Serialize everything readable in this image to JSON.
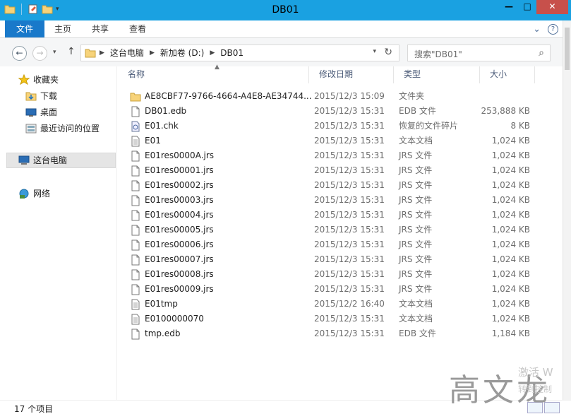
{
  "window": {
    "title": "DB01",
    "minimize": "—",
    "maximize": "□",
    "close": "✕"
  },
  "ribbon": {
    "tabs": [
      "文件",
      "主页",
      "共享",
      "查看"
    ],
    "collapse": "⌄",
    "help": "?"
  },
  "address": {
    "crumbs": [
      "这台电脑",
      "新加卷 (D:)",
      "DB01"
    ],
    "search_placeholder": "搜索\"DB01\""
  },
  "nav": {
    "items": [
      {
        "label": "收藏夹",
        "icon": "star-icon"
      },
      {
        "label": "下载",
        "icon": "download-folder-icon"
      },
      {
        "label": "桌面",
        "icon": "desktop-icon"
      },
      {
        "label": "最近访问的位置",
        "icon": "recent-places-icon"
      },
      {
        "label": "这台电脑",
        "icon": "computer-icon"
      },
      {
        "label": "网络",
        "icon": "network-icon"
      }
    ]
  },
  "columns": [
    "名称",
    "修改日期",
    "类型",
    "大小"
  ],
  "files": [
    {
      "name": "AE8CBF77-9766-4664-A4E8-AE34744...",
      "date": "2015/12/3 15:09",
      "type": "文件夹",
      "size": "",
      "icon": "folder-icon"
    },
    {
      "name": "DB01.edb",
      "date": "2015/12/3 15:31",
      "type": "EDB 文件",
      "size": "253,888 KB",
      "icon": "file-icon"
    },
    {
      "name": "E01.chk",
      "date": "2015/12/3 15:31",
      "type": "恢复的文件碎片",
      "size": "8 KB",
      "icon": "chk-file-icon"
    },
    {
      "name": "E01",
      "date": "2015/12/3 15:31",
      "type": "文本文档",
      "size": "1,024 KB",
      "icon": "text-file-icon"
    },
    {
      "name": "E01res0000A.jrs",
      "date": "2015/12/3 15:31",
      "type": "JRS 文件",
      "size": "1,024 KB",
      "icon": "file-icon"
    },
    {
      "name": "E01res00001.jrs",
      "date": "2015/12/3 15:31",
      "type": "JRS 文件",
      "size": "1,024 KB",
      "icon": "file-icon"
    },
    {
      "name": "E01res00002.jrs",
      "date": "2015/12/3 15:31",
      "type": "JRS 文件",
      "size": "1,024 KB",
      "icon": "file-icon"
    },
    {
      "name": "E01res00003.jrs",
      "date": "2015/12/3 15:31",
      "type": "JRS 文件",
      "size": "1,024 KB",
      "icon": "file-icon"
    },
    {
      "name": "E01res00004.jrs",
      "date": "2015/12/3 15:31",
      "type": "JRS 文件",
      "size": "1,024 KB",
      "icon": "file-icon"
    },
    {
      "name": "E01res00005.jrs",
      "date": "2015/12/3 15:31",
      "type": "JRS 文件",
      "size": "1,024 KB",
      "icon": "file-icon"
    },
    {
      "name": "E01res00006.jrs",
      "date": "2015/12/3 15:31",
      "type": "JRS 文件",
      "size": "1,024 KB",
      "icon": "file-icon"
    },
    {
      "name": "E01res00007.jrs",
      "date": "2015/12/3 15:31",
      "type": "JRS 文件",
      "size": "1,024 KB",
      "icon": "file-icon"
    },
    {
      "name": "E01res00008.jrs",
      "date": "2015/12/3 15:31",
      "type": "JRS 文件",
      "size": "1,024 KB",
      "icon": "file-icon"
    },
    {
      "name": "E01res00009.jrs",
      "date": "2015/12/3 15:31",
      "type": "JRS 文件",
      "size": "1,024 KB",
      "icon": "file-icon"
    },
    {
      "name": "E01tmp",
      "date": "2015/12/2 16:40",
      "type": "文本文档",
      "size": "1,024 KB",
      "icon": "text-file-icon"
    },
    {
      "name": "E0100000070",
      "date": "2015/12/3 15:31",
      "type": "文本文档",
      "size": "1,024 KB",
      "icon": "text-file-icon"
    },
    {
      "name": "tmp.edb",
      "date": "2015/12/3 15:31",
      "type": "EDB 文件",
      "size": "1,184 KB",
      "icon": "file-icon"
    }
  ],
  "status": {
    "count": "17 个项目"
  },
  "watermark": {
    "main": "高文龙",
    "activate": "激活 W",
    "activate_sub": "转到控制"
  },
  "colors": {
    "titlebar": "#1aa1e1",
    "file_tab": "#1979ca",
    "close_button": "#c7504b"
  }
}
